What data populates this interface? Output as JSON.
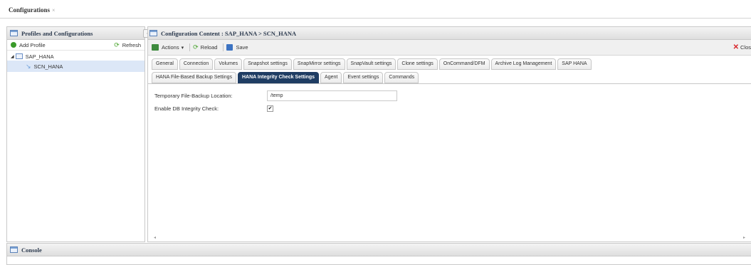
{
  "document_tab": {
    "label": "Configurations",
    "close_glyph": "×"
  },
  "left_panel": {
    "title": "Profiles and Configurations",
    "collapse_glyph": "«",
    "add_profile_label": "Add Profile",
    "refresh_label": "Refresh",
    "tree": [
      {
        "label": "SAP_HANA",
        "level": 0,
        "expanded": true
      },
      {
        "label": "SCN_HANA",
        "level": 1,
        "selected": true
      }
    ]
  },
  "right_panel": {
    "title": "Configuration Content : SAP_HANA > SCN_HANA",
    "toolbar": {
      "actions_label": "Actions",
      "actions_caret": "▾",
      "reload_label": "Reload",
      "save_label": "Save",
      "close_label": "Clos"
    },
    "tabs_row1": [
      "General",
      "Connection",
      "Volumes",
      "Snapshot settings",
      "SnapMirror settings",
      "SnapVault settings",
      "Clone settings",
      "OnCommand/DFM",
      "Archive Log Management",
      "SAP HANA"
    ],
    "tabs_row2": [
      "HANA File-Based Backup Settings",
      "HANA Integrity Check Settings",
      "Agent",
      "Event settings",
      "Commands"
    ],
    "active_tab": "HANA Integrity Check Settings",
    "form": {
      "temp_location_label": "Temporary File-Backup Location:",
      "temp_location_value": "/temp",
      "integrity_check_label": "Enable DB Integrity Check:",
      "integrity_check_checked": true,
      "check_glyph": "✔"
    },
    "scroll_left_glyph": "◂",
    "scroll_right_glyph": "▸"
  },
  "console": {
    "title": "Console"
  },
  "colors": {
    "active_tab_bg": "#1f3d63",
    "selection_bg": "#dce7f7",
    "close_red": "#d8252a"
  }
}
